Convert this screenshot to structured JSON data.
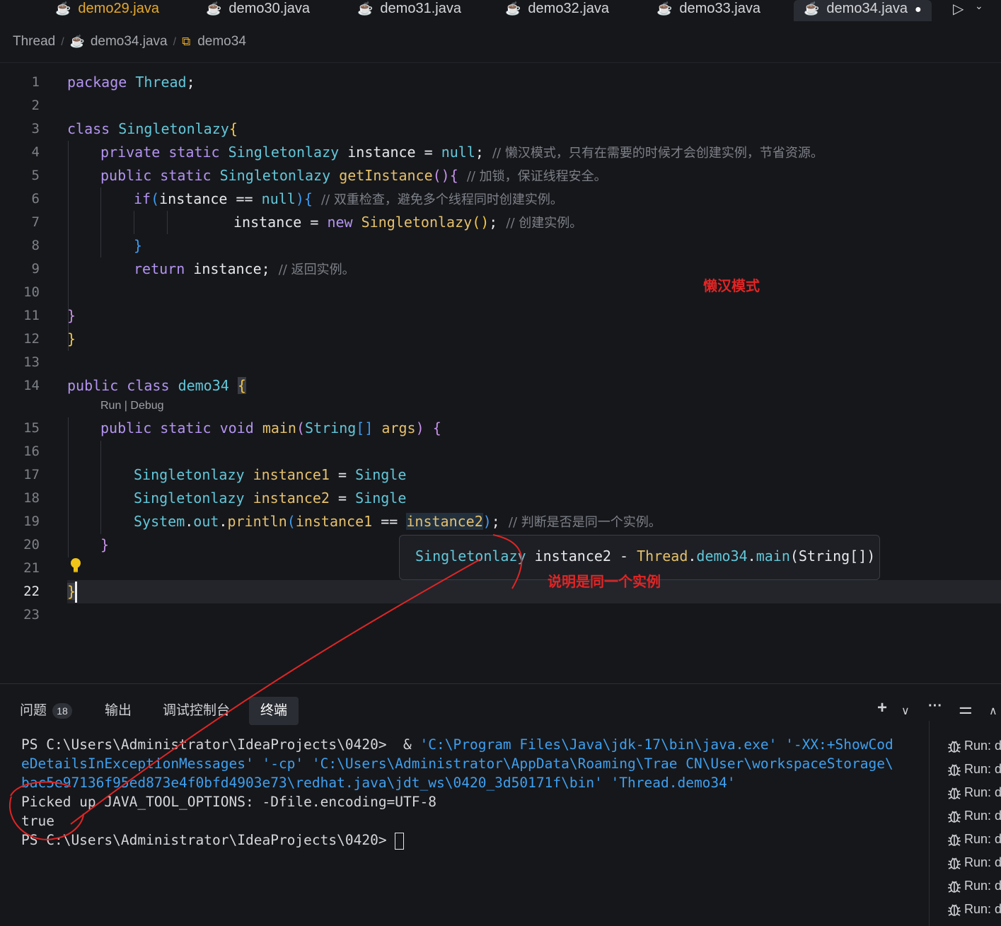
{
  "tabs": [
    {
      "label": "demo29.java"
    },
    {
      "label": "demo30.java"
    },
    {
      "label": "demo31.java"
    },
    {
      "label": "demo32.java"
    },
    {
      "label": "demo33.java"
    },
    {
      "label": "demo34.java"
    }
  ],
  "breadcrumb": {
    "folder": "Thread",
    "file": "demo34.java",
    "symbol": "demo34"
  },
  "editor": {
    "line_numbers": [
      "1",
      "2",
      "3",
      "4",
      "5",
      "6",
      "7",
      "8",
      "9",
      "10",
      "11",
      "12",
      "13",
      "14",
      "15",
      "16",
      "17",
      "18",
      "19",
      "20",
      "21",
      "22",
      "23"
    ],
    "lines": {
      "l1": [
        "package",
        "Thread",
        ";"
      ],
      "l3": [
        "class",
        "Singletonlazy",
        "{"
      ],
      "l4": [
        "private",
        "static",
        "Singletonlazy",
        "instance",
        "=",
        "null",
        ";",
        "// 懒汉模式，只有在需要的时候才会创建实例，节省资源。"
      ],
      "l5": [
        "public",
        "static",
        "Singletonlazy",
        "getInstance",
        "()",
        "{",
        "// 加锁，保证线程安全。"
      ],
      "l6": [
        "if",
        "(",
        "instance",
        "==",
        "null",
        ")",
        "{",
        "// 双重检查，避免多个线程同时创建实例。"
      ],
      "l7": [
        "instance",
        "=",
        "new",
        "Singletonlazy",
        "()",
        ";",
        "// 创建实例。"
      ],
      "l8": [
        "}"
      ],
      "l9": [
        "return",
        "instance",
        ";",
        "// 返回实例。"
      ],
      "l11": [
        "}"
      ],
      "l12": [
        "}"
      ],
      "l14": [
        "public",
        "class",
        "demo34",
        "{"
      ],
      "l15": [
        "public",
        "static",
        "void",
        "main",
        "(",
        "String",
        "[]",
        "args",
        ")",
        "{"
      ],
      "l17": [
        "Singletonlazy",
        "instance1",
        "=",
        "Single"
      ],
      "l18": [
        "Singletonlazy",
        "instance2",
        "=",
        "Single"
      ],
      "l19": [
        "System",
        ".",
        "out",
        ".",
        "println",
        "(",
        "instance1",
        "==",
        "instance2",
        ")",
        ";",
        "// 判断是否是同一个实例。"
      ],
      "l20": [
        "}"
      ],
      "l22": [
        "}"
      ]
    },
    "codelens": "Run | Debug",
    "hover": {
      "type": "Singletonlazy",
      "name": "instance2",
      "sep": "-",
      "owner": "Thread",
      "dot1": ".",
      "cls": "demo34",
      "dot2": ".",
      "method": "main",
      "args": "(String[])"
    }
  },
  "annotations": {
    "lazy_mode": "懒汉模式",
    "same_instance": "说明是同一个实例"
  },
  "panel": {
    "tabs": {
      "problems": "问题",
      "problems_count": "18",
      "output": "输出",
      "debug_console": "调试控制台",
      "terminal": "终端"
    },
    "actions": {
      "add": "+",
      "chevron": "∨",
      "more": "···",
      "layout": "⚌",
      "collapse": "∧"
    },
    "terminal_lines": {
      "t1_prompt": "PS C:\\Users\\Administrator\\IdeaProjects\\0420>  & ",
      "t1_str": "'C:\\Program Files\\Java\\jdk-17\\bin\\java.exe' '-XX:+ShowCod",
      "t2": "eDetailsInExceptionMessages' '-cp' 'C:\\Users\\Administrator\\AppData\\Roaming\\Trae CN\\User\\workspaceStorage\\",
      "t3": "bac5e97136f95ed873e4f0bfd4903e73\\redhat.java\\jdt_ws\\0420_3d50171f\\bin' 'Thread.demo34'",
      "t4": "Picked up JAVA_TOOL_OPTIONS: -Dfile.encoding=UTF-8",
      "t5": "true",
      "t6": "PS C:\\Users\\Administrator\\IdeaProjects\\0420> "
    },
    "run_items": [
      "Run: d",
      "Run: d",
      "Run: d",
      "Run: d",
      "Run: d",
      "Run: d",
      "Run: d",
      "Run: d"
    ]
  },
  "colors": {
    "accent": "#e5a82a",
    "annotation": "#e02525",
    "terminal_string": "#3ea0f0"
  }
}
